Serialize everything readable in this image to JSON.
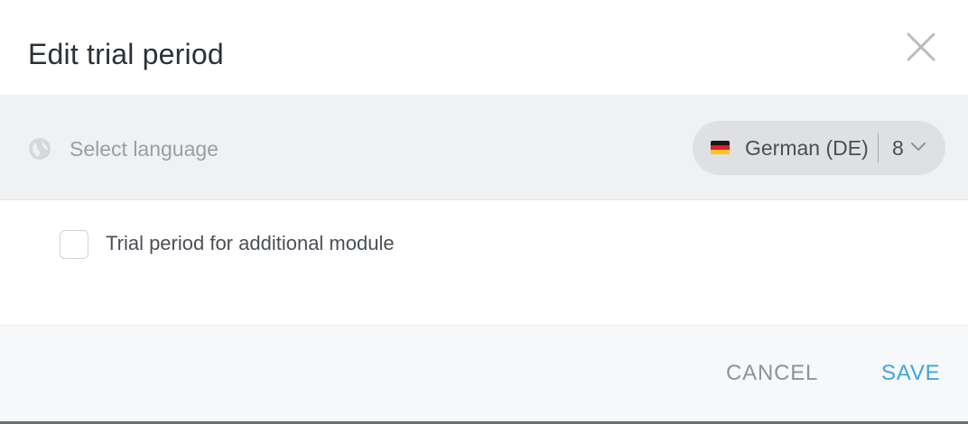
{
  "dialog": {
    "title": "Edit trial period"
  },
  "language_bar": {
    "select_label": "Select language",
    "current_language": "German (DE)",
    "language_count": "8"
  },
  "options": {
    "trial_checkbox_label": "Trial period for additional module",
    "trial_checkbox_checked": false
  },
  "footer": {
    "cancel_label": "CANCEL",
    "save_label": "SAVE"
  },
  "icons": {
    "close": "close-icon",
    "globe": "globe-icon",
    "flag": "german-flag-icon",
    "chevron": "chevron-down-icon"
  },
  "colors": {
    "accent": "#3ea6dc",
    "cancel_text": "#8f9297",
    "lang_bar_bg": "#f0f1f3",
    "pill_bg": "#dfe0e3",
    "footer_bg": "#f7f8f9"
  }
}
